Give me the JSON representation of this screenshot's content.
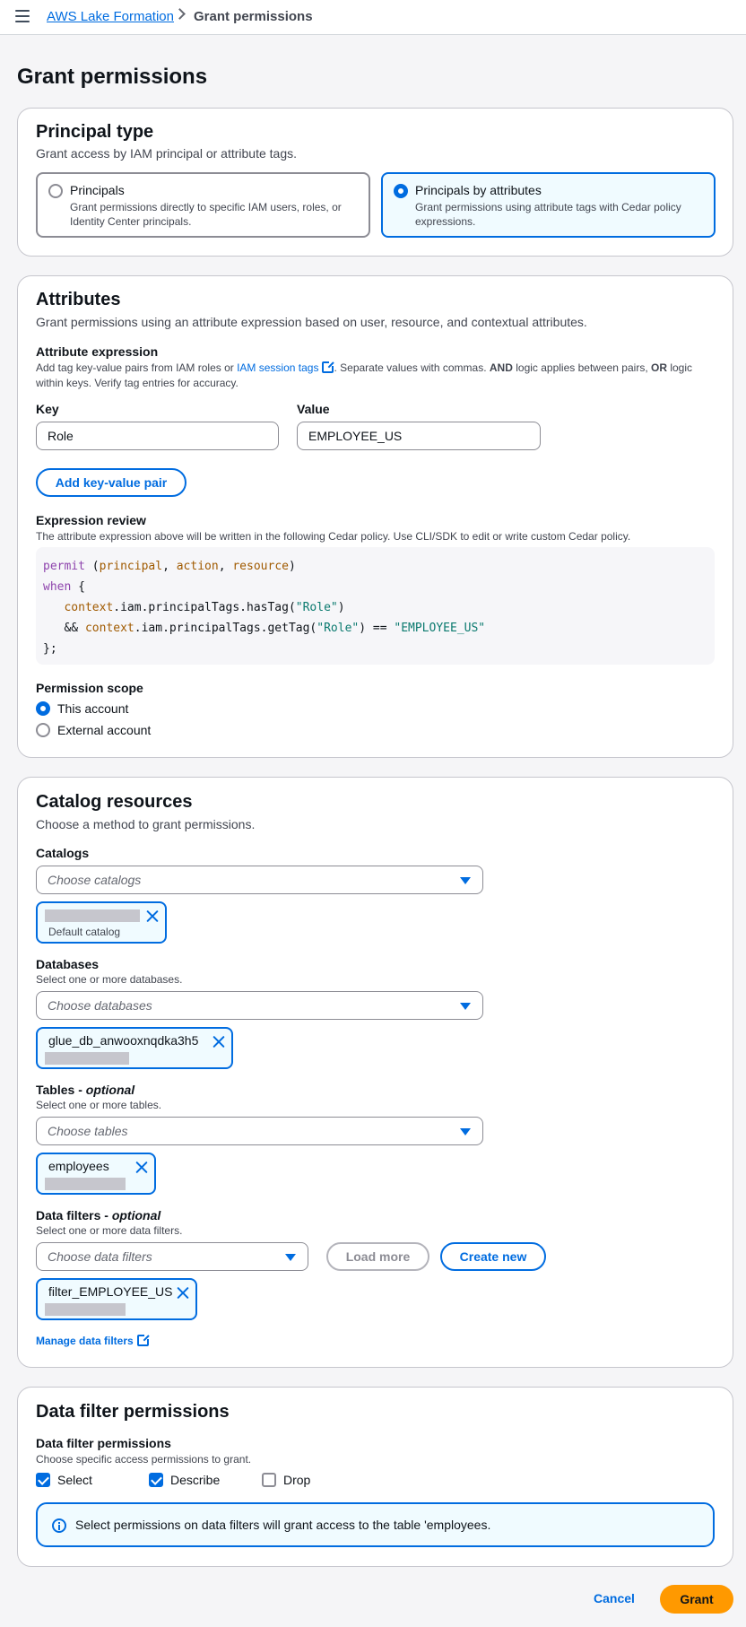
{
  "breadcrumb": {
    "root": "AWS Lake Formation",
    "current": "Grant permissions"
  },
  "page_title": "Grant permissions",
  "principal_type": {
    "title": "Principal type",
    "description": "Grant access by IAM principal or attribute tags.",
    "options": [
      {
        "title": "Principals",
        "description": "Grant permissions directly to specific IAM users, roles, or Identity Center principals.",
        "selected": false
      },
      {
        "title": "Principals by attributes",
        "description": "Grant permissions using attribute tags with Cedar policy expressions.",
        "selected": true
      }
    ]
  },
  "attributes": {
    "title": "Attributes",
    "description": "Grant permissions using an attribute expression based on user, resource, and contextual attributes.",
    "expression_label": "Attribute expression",
    "expression_help_prefix": "Add tag key-value pairs from IAM roles or ",
    "expression_help_link": "IAM session tags",
    "expression_help_mid": ". Separate values with commas. ",
    "expression_help_and": "AND",
    "expression_help_mid2": " logic applies between pairs, ",
    "expression_help_or": "OR",
    "expression_help_suffix": " logic within keys. Verify tag entries for accuracy.",
    "key_label": "Key",
    "key_value": "Role",
    "value_label": "Value",
    "value_value": "EMPLOYEE_US",
    "add_pair_button": "Add key-value pair",
    "review_label": "Expression review",
    "review_help": "The attribute expression above will be written in the following Cedar policy. Use CLI/SDK to edit or write custom Cedar policy.",
    "code": {
      "permit": "permit",
      "principal": "principal",
      "action": "action",
      "resource": "resource",
      "when": "when",
      "context": "context",
      "has_tag": ".iam.principalTags.hasTag(",
      "get_tag": ".iam.principalTags.getTag(",
      "key_str": "\"Role\"",
      "value_str": "\"EMPLOYEE_US\""
    },
    "scope_label": "Permission scope",
    "scope_options": [
      {
        "label": "This account",
        "selected": true
      },
      {
        "label": "External account",
        "selected": false
      }
    ]
  },
  "catalog_resources": {
    "title": "Catalog resources",
    "description": "Choose a method to grant permissions.",
    "catalogs": {
      "label": "Catalogs",
      "placeholder": "Choose catalogs",
      "token_sub": "Default catalog"
    },
    "databases": {
      "label": "Databases",
      "help": "Select one or more databases.",
      "placeholder": "Choose databases",
      "token": "glue_db_anwooxnqdka3h5"
    },
    "tables": {
      "label": "Tables - ",
      "label_optional": "optional",
      "help": "Select one or more tables.",
      "placeholder": "Choose tables",
      "token": "employees"
    },
    "data_filters": {
      "label": "Data filters - ",
      "label_optional": "optional",
      "help": "Select one or more data filters.",
      "placeholder": "Choose data filters",
      "load_more": "Load more",
      "create_new": "Create new",
      "token": "filter_EMPLOYEE_US",
      "manage_link": "Manage data filters"
    }
  },
  "data_filter_permissions": {
    "title": "Data filter permissions",
    "label": "Data filter permissions",
    "help": "Choose specific access permissions to grant.",
    "checkboxes": [
      {
        "label": "Select",
        "checked": true
      },
      {
        "label": "Describe",
        "checked": true
      },
      {
        "label": "Drop",
        "checked": false
      }
    ],
    "alert": "Select permissions on data filters will grant access to the table 'employees."
  },
  "footer": {
    "cancel": "Cancel",
    "grant": "Grant"
  }
}
